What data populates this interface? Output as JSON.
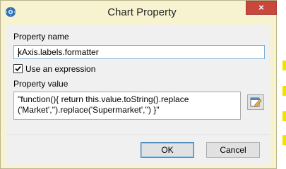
{
  "window": {
    "title": "Chart Property",
    "close_symbol": "×",
    "app_icon": "gear-app-icon"
  },
  "form": {
    "property_name_label": "Property name",
    "property_name_value": "xAxis.labels.formatter",
    "use_expression_label": "Use an expression",
    "use_expression_checked": true,
    "property_value_label": "Property value",
    "property_value_lines": [
      "\"function(){ return this.value.toString().replace",
      "('Market','').replace('Supermarket','') }\""
    ],
    "expression_button_icon": "edit-expression-icon"
  },
  "footer": {
    "ok_label": "OK",
    "cancel_label": "Cancel"
  },
  "colors": {
    "dialog_frame": "#f7f3d0",
    "close_button": "#c9483c",
    "focus_border": "#7ab0d9",
    "background_marks": "#f2e200"
  }
}
